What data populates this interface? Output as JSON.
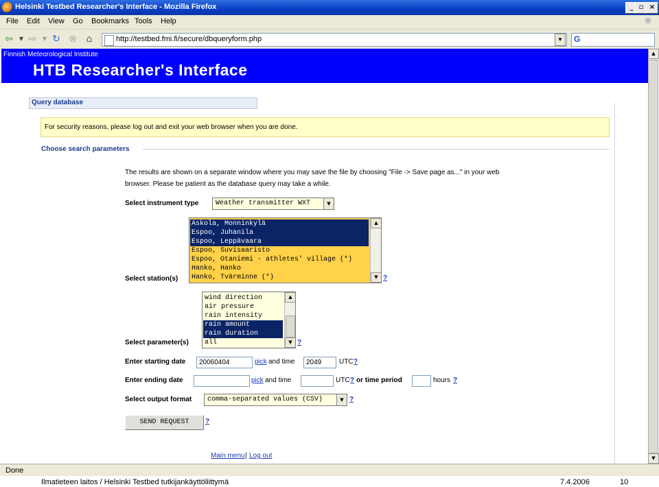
{
  "window": {
    "title": "Helsinki Testbed Researcher's Interface - Mozilla Firefox",
    "btn_min": "_",
    "btn_max": "▫",
    "btn_close": "×"
  },
  "menu": [
    {
      "label": "File"
    },
    {
      "label": "Edit"
    },
    {
      "label": "View"
    },
    {
      "label": "Go"
    },
    {
      "label": "Bookmarks"
    },
    {
      "label": "Tools"
    },
    {
      "label": "Help"
    }
  ],
  "nav": {
    "url": "http://testbed.fmi.fi/secure/dbqueryform.php",
    "search_glyph": "G"
  },
  "banner": {
    "org": "Finnish Meteorological Institute",
    "heading": "HTB Researcher's Interface"
  },
  "section_title": "Query database",
  "notice": "For security reasons, please log out and exit your web browser when you are done.",
  "params_title": "Choose search parameters",
  "intro_line1": "The results are shown on a separate window where you may save the file by choosing \"File -> Save page as...\" in your web",
  "intro_line2": "browser. Please be patient as the database query may take a while.",
  "instrument": {
    "label": "Select instrument type",
    "value": "Weather transmitter WXT"
  },
  "stations": {
    "label": "Select station(s)",
    "options": [
      {
        "text": "Askola, Monninkylä",
        "selected": true
      },
      {
        "text": "Espoo, Juhanila",
        "selected": true
      },
      {
        "text": "Espoo, Leppävaara",
        "selected": true
      },
      {
        "text": "Espoo, Suvisaaristo",
        "selected": false
      },
      {
        "text": "Espoo, Otaniemi - athletes' village (*)",
        "selected": false
      },
      {
        "text": "Hanko, Hanko",
        "selected": false
      },
      {
        "text": "Hanko, Tvärminne (*)",
        "selected": false
      }
    ]
  },
  "parameters": {
    "label": "Select parameter(s)",
    "options": [
      {
        "text": "wind direction",
        "selected": false
      },
      {
        "text": "air pressure",
        "selected": false
      },
      {
        "text": "rain intensity",
        "selected": false
      },
      {
        "text": "rain amount",
        "selected": true
      },
      {
        "text": "rain duration",
        "selected": true
      },
      {
        "text": "all",
        "selected": false
      }
    ]
  },
  "start": {
    "label": "Enter starting date",
    "date": "20060404",
    "pick": "pick",
    "and_time": "and time",
    "time": "2049",
    "utc": "UTC"
  },
  "end": {
    "label": "Enter ending date",
    "date": "",
    "pick": "pick",
    "and_time": "and time",
    "time": "",
    "utc": "UTC",
    "or_period": "or time period",
    "hours_value": "",
    "hours": "hours"
  },
  "format": {
    "label": "Select output format",
    "value": "comma-separated values (CSV)"
  },
  "help": "?",
  "send_button": "SEND REQUEST",
  "links": {
    "main_menu": "Main menu",
    "separator": "|",
    "log_out": "Log out"
  },
  "status": "Done",
  "footer": {
    "left": "Ilmatieteen laitos / Helsinki Testbed tutkijankäyttöliittymä",
    "date": "7.4.2006",
    "page": "10"
  }
}
